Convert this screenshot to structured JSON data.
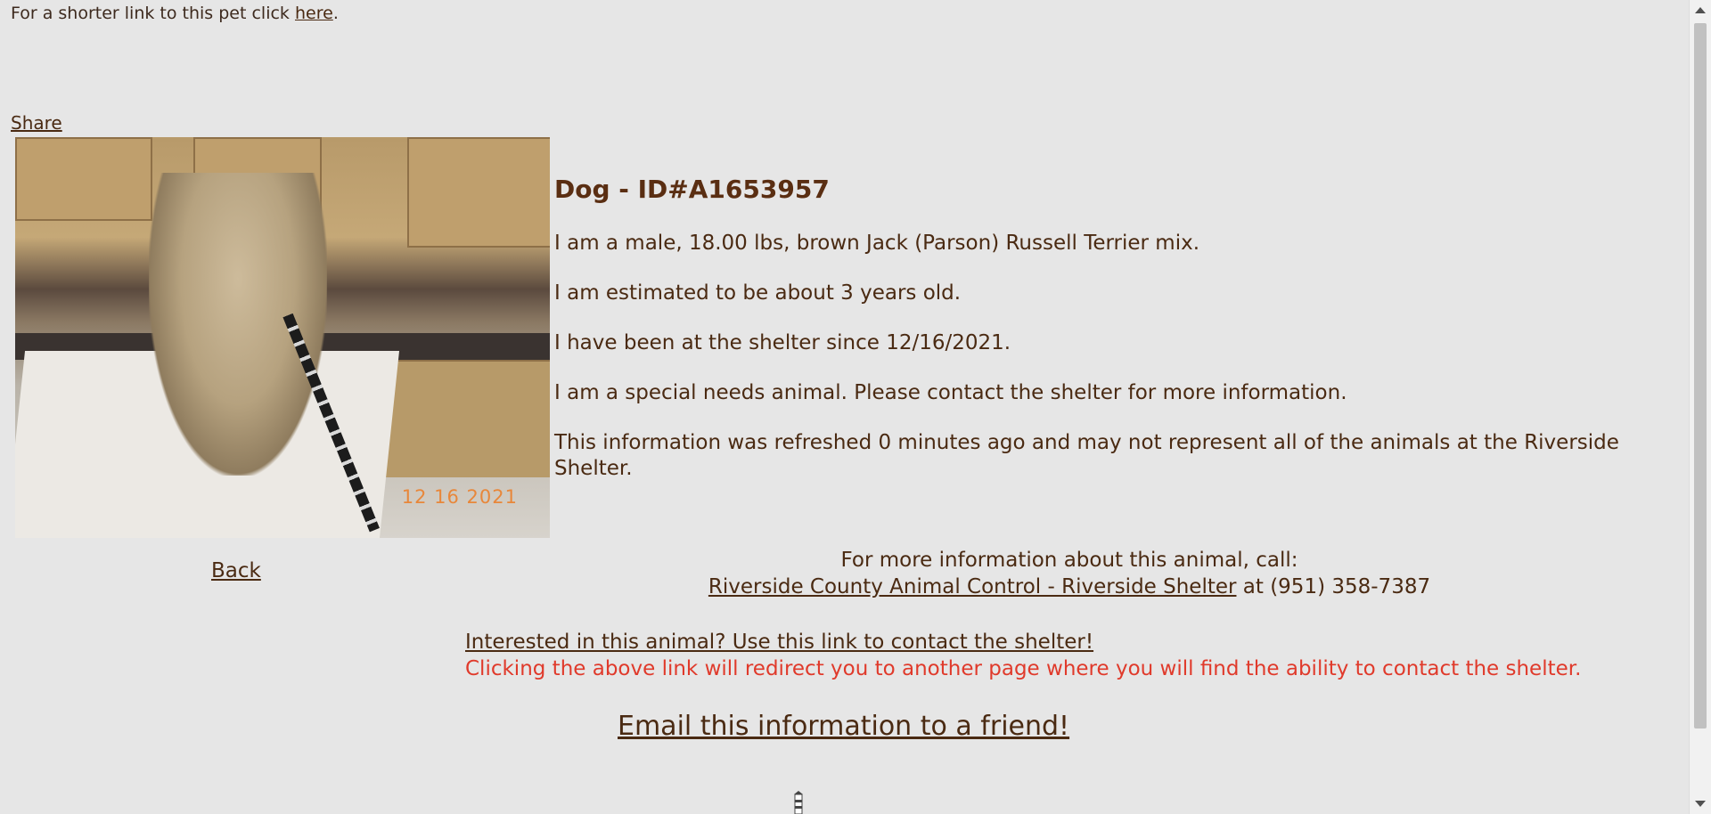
{
  "top_line": {
    "text": "For a shorter link to this pet click ",
    "link": "here",
    "trailing": "."
  },
  "share_label": "Share",
  "photo": {
    "date_stamp": "12 16 2021"
  },
  "back_label": "Back",
  "animal": {
    "heading": "Dog - ID#A1653957",
    "description": "I am a male, 18.00 lbs, brown Jack (Parson) Russell Terrier mix.",
    "age": "I am estimated to be about 3 years old.",
    "since": "I have been at the shelter since 12/16/2021.",
    "special_needs": "I am a special needs animal. Please contact the shelter for more information.",
    "refresh_note": "This information was refreshed 0 minutes ago and may not represent all of the animals at the Riverside Shelter."
  },
  "contact": {
    "intro": "For more information about this animal, call:",
    "shelter_link": "Riverside County Animal Control - Riverside Shelter",
    "at": " at ",
    "phone": "(951) 358-7387"
  },
  "interest": {
    "link": "Interested in this animal? Use this link to contact the shelter!",
    "note": "Clicking the above link will redirect you to another page where you will find the ability to contact the shelter."
  },
  "email_label": "Email this information to a friend!",
  "icons": {
    "bottom": "lighthouse-icon"
  },
  "colors": {
    "background": "#e6e6e6",
    "text": "#4a2a12",
    "warning": "#e03a2b"
  }
}
